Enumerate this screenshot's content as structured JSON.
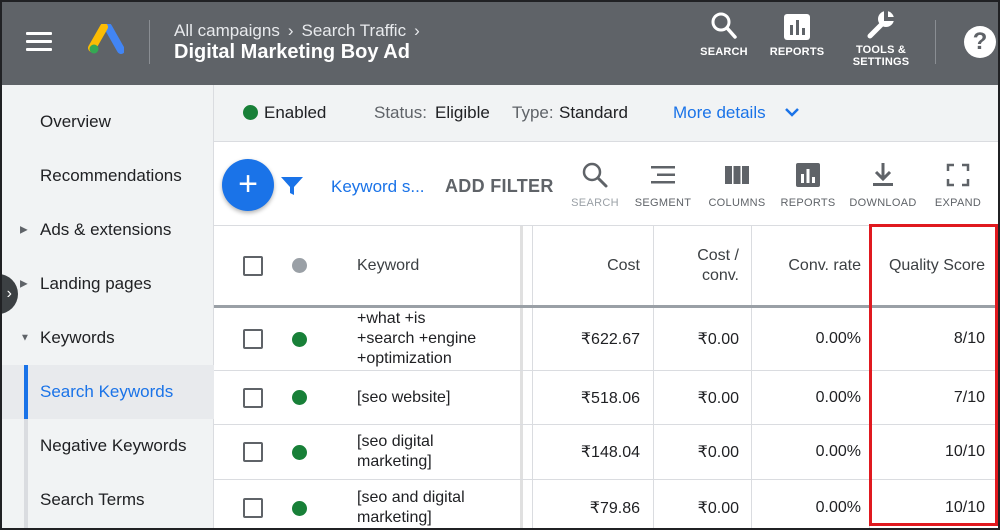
{
  "header": {
    "breadcrumb": [
      "All campaigns",
      "Search Traffic"
    ],
    "title": "Digital Marketing Boy Ad",
    "buttons": [
      {
        "label": "SEARCH",
        "icon": "search-icon"
      },
      {
        "label": "REPORTS",
        "icon": "reports-icon"
      },
      {
        "label_line1": "TOOLS &",
        "label_line2": "SETTINGS",
        "icon": "wrench-icon"
      }
    ],
    "help": "?"
  },
  "sidebar": {
    "items": [
      {
        "label": "Overview"
      },
      {
        "label": "Recommendations"
      },
      {
        "label": "Ads & extensions",
        "expandable": true
      },
      {
        "label": "Landing pages",
        "expandable": true
      },
      {
        "label": "Keywords",
        "expanded": true
      },
      {
        "label": "Search Keywords",
        "active": true
      },
      {
        "label": "Negative Keywords"
      },
      {
        "label": "Search Terms"
      }
    ]
  },
  "status_bar": {
    "state": "Enabled",
    "status_label": "Status:",
    "status_value": "Eligible",
    "type_label": "Type:",
    "type_value": "Standard",
    "more_details": "More details"
  },
  "toolbar": {
    "add_button": "+",
    "filter_chip": "Keyword s...",
    "add_filter": "ADD FILTER",
    "tools": [
      "SEARCH",
      "SEGMENT",
      "COLUMNS",
      "REPORTS",
      "DOWNLOAD",
      "EXPAND"
    ]
  },
  "table": {
    "columns": {
      "keyword": "Keyword",
      "cost": "Cost",
      "cost_conv_line1": "Cost /",
      "cost_conv_line2": "conv.",
      "conv_rate": "Conv. rate",
      "quality_score": "Quality Score"
    },
    "rows": [
      {
        "kw_lines": [
          "+what +is",
          "+search +engine",
          "+optimization"
        ],
        "cost": "₹622.67",
        "cost_conv": "₹0.00",
        "conv_rate": "0.00%",
        "quality_score": "8/10"
      },
      {
        "kw_lines": [
          "[seo website]"
        ],
        "cost": "₹518.06",
        "cost_conv": "₹0.00",
        "conv_rate": "0.00%",
        "quality_score": "7/10"
      },
      {
        "kw_lines": [
          "[seo digital",
          "marketing]"
        ],
        "cost": "₹148.04",
        "cost_conv": "₹0.00",
        "conv_rate": "0.00%",
        "quality_score": "10/10"
      },
      {
        "kw_lines": [
          "[seo and digital",
          "marketing]"
        ],
        "cost": "₹79.86",
        "cost_conv": "₹0.00",
        "conv_rate": "0.00%",
        "quality_score": "10/10"
      }
    ]
  },
  "colors": {
    "header_bg": "#5f6368",
    "accent": "#1a73e8",
    "enabled_green": "#188038",
    "highlight_red": "#e0191f"
  }
}
